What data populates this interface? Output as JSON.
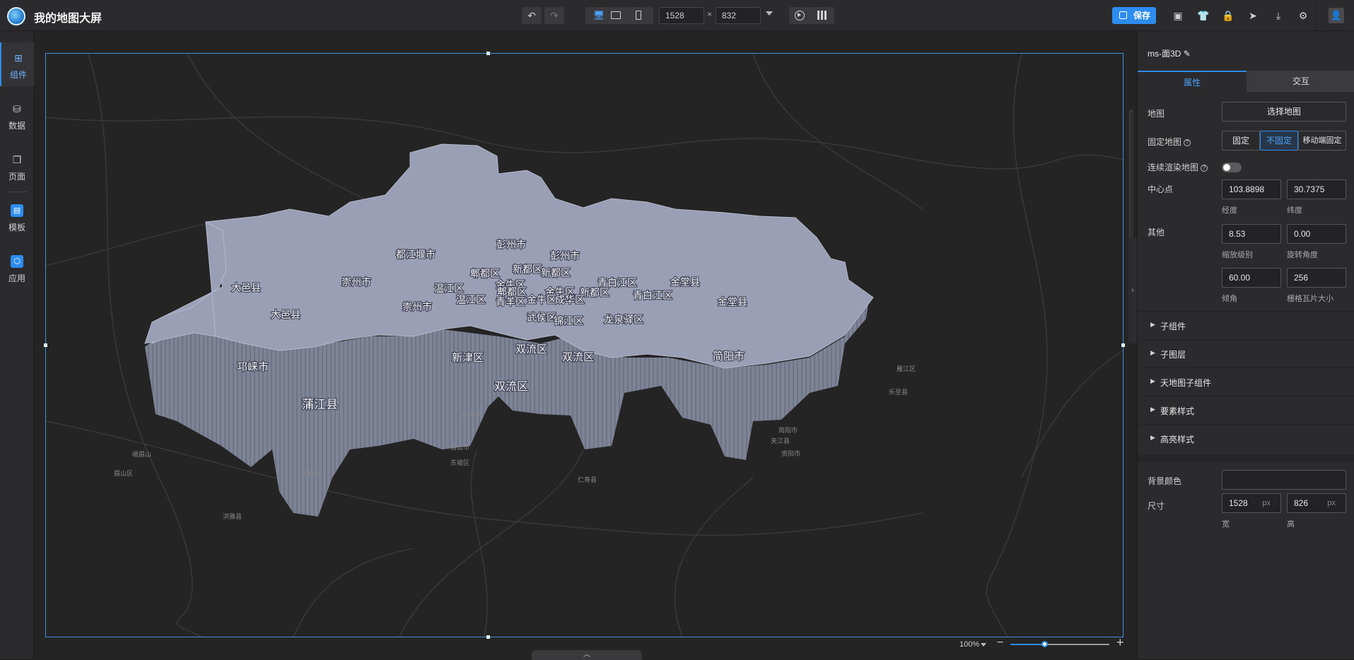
{
  "header": {
    "title": "我的地图大屏",
    "width_value": "1528",
    "height_value": "832",
    "times_sign": "×",
    "save_label": "保存"
  },
  "sidebar": {
    "items": [
      {
        "label": "组件",
        "icon": "components-icon",
        "active": true
      },
      {
        "label": "数据",
        "icon": "database-icon",
        "active": false
      },
      {
        "label": "页面",
        "icon": "pages-icon",
        "active": false
      },
      {
        "label": "模板",
        "icon": "template-icon",
        "active": false
      },
      {
        "label": "应用",
        "icon": "app-icon",
        "active": false
      }
    ]
  },
  "map": {
    "district_labels": [
      "彭州市",
      "都江堰市",
      "彭州市",
      "崇州市",
      "新都区",
      "郫都区",
      "新都区",
      "温江区",
      "金牛区",
      "郫都区",
      "金牛区",
      "新都区",
      "青白江区",
      "金堂县",
      "大邑县",
      "温江区",
      "青羊区",
      "金牛区",
      "成华区",
      "青白江区",
      "金堂县",
      "崇州市",
      "武侯区",
      "锦江区",
      "龙泉驿区",
      "大邑县",
      "新津区",
      "双流区",
      "双流区",
      "简阳市",
      "邛崃市",
      "双流区",
      "蒲江县"
    ],
    "basemap_labels": [
      "彭山县",
      "眉山市",
      "东坡区",
      "仁寿县",
      "丹棱县",
      "洪雅县",
      "夹江县",
      "峨眉山",
      "眉山区",
      "简阳市",
      "乐至县",
      "资阳市",
      "雁江区"
    ],
    "zoom": "100%",
    "zoom_fraction": 0.35
  },
  "panel": {
    "component_name": "ms-面3D",
    "tabs": [
      "属性",
      "交互"
    ],
    "map_label": "地图",
    "select_map": "选择地图",
    "fix_map_label": "固定地图",
    "fix_options": [
      "固定",
      "不固定",
      "移动端固定"
    ],
    "fix_selected": "不固定",
    "continuous_label": "连续渲染地图",
    "center_label": "中心点",
    "longitude": "103.8898",
    "latitude": "30.7375",
    "longitude_label": "经度",
    "latitude_label": "纬度",
    "other_label": "其他",
    "zoom_level": "8.53",
    "rotation": "0.00",
    "zoom_level_label": "缩放级别",
    "rotation_label": "旋转角度",
    "pitch": "60.00",
    "tile_size": "256",
    "pitch_label": "倾角",
    "tile_size_label": "栅格瓦片大小",
    "sections": [
      "子组件",
      "子图层",
      "天地图子组件",
      "要素样式",
      "高亮样式"
    ],
    "bg_color_label": "背景颜色",
    "size_label": "尺寸",
    "width": "1528",
    "height": "826",
    "px_unit": "px",
    "width_label": "宽",
    "height_label": "高"
  },
  "colors": {
    "accent": "#2d8cf0",
    "map_top": "#9b9fb5",
    "map_side": "#7e8295"
  }
}
